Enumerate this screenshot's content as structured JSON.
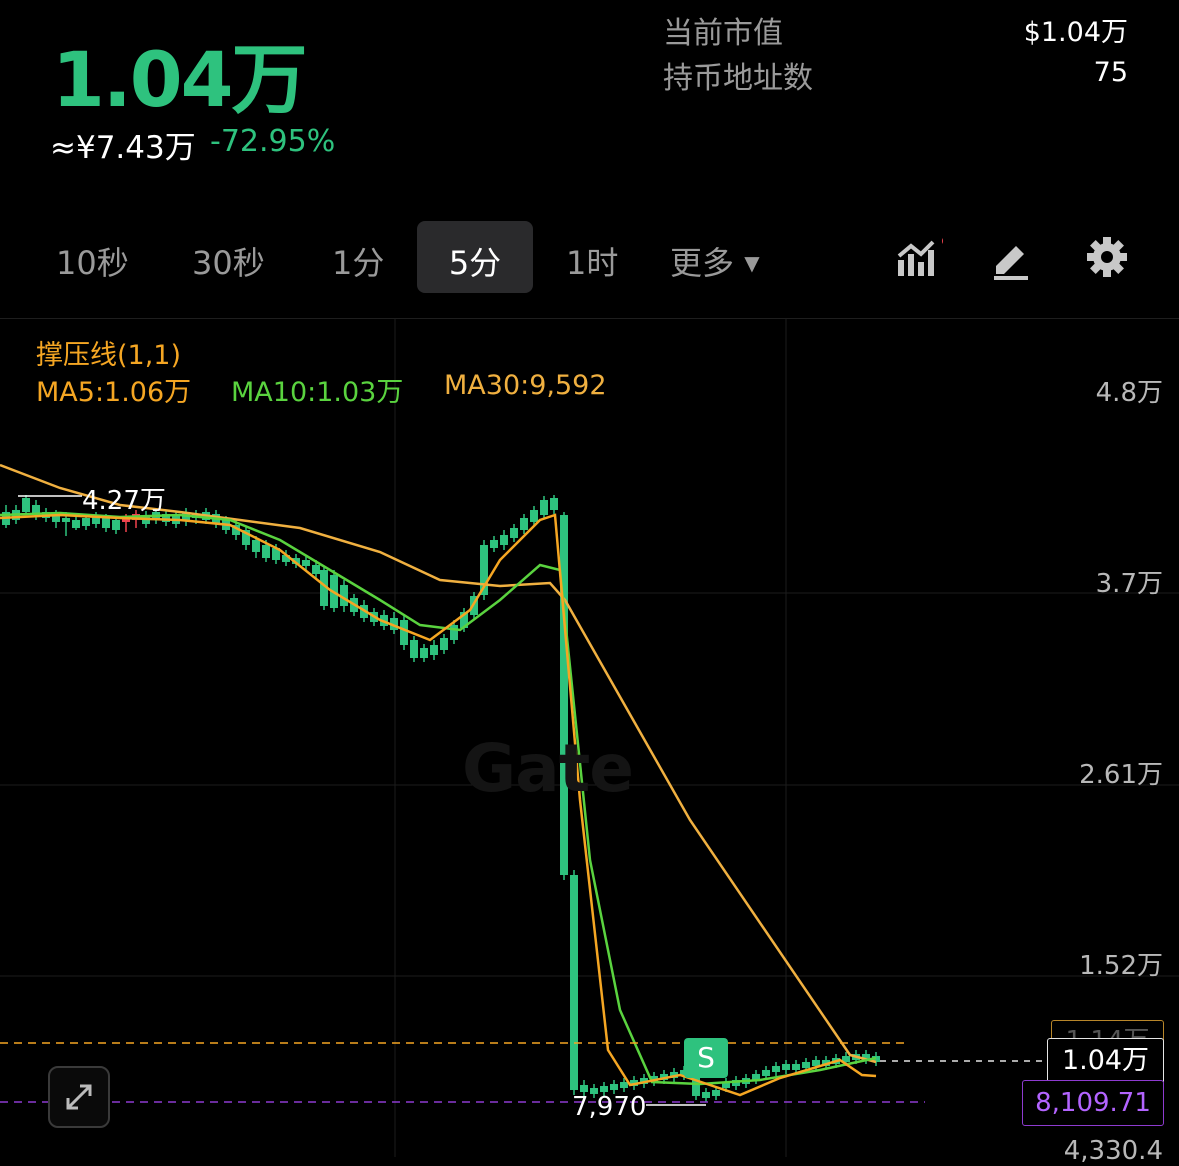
{
  "header": {
    "price": "1.04万",
    "fiat_price": "≈¥7.43万",
    "change": "-72.95%",
    "stats": [
      {
        "label": "当前市值",
        "value": "$1.04万"
      },
      {
        "label": "持币地址数",
        "value": "75"
      }
    ]
  },
  "timeframes": {
    "items": [
      "10秒",
      "30秒",
      "1分",
      "5分",
      "1时"
    ],
    "active": "5分",
    "more_label": "更多"
  },
  "toolbar": {
    "icons": [
      "indicators-icon",
      "draw-icon",
      "settings-icon"
    ],
    "indicator_dot_color": "#f0434e"
  },
  "legend": {
    "support_resistance": "撑压线(1,1)",
    "ma5": "MA5:1.06万",
    "ma10": "MA10:1.03万",
    "ma30": "MA30:9,592"
  },
  "watermark": "Gate",
  "chart_data": {
    "type": "candlestick",
    "y_axis_labels": [
      "4.8万",
      "3.7万",
      "2.61万",
      "1.52万",
      "4,330.4"
    ],
    "y_axis_values": [
      48000,
      37000,
      26100,
      15200,
      4330.4
    ],
    "high_marker": "4.27万",
    "low_marker": "7,970",
    "current_price_tag": "1.04万",
    "orange_line_tag": "1.14万",
    "purple_line_tag": "8,109.71",
    "sell_marker": "S",
    "colors": {
      "up": "#f0434e",
      "down": "#2ec27e",
      "ma5": "#f5a623",
      "ma10": "#5ad33f",
      "ma30": "#f0b040",
      "support_line": "#f5a623",
      "purple_line": "#8e3bd0"
    }
  }
}
